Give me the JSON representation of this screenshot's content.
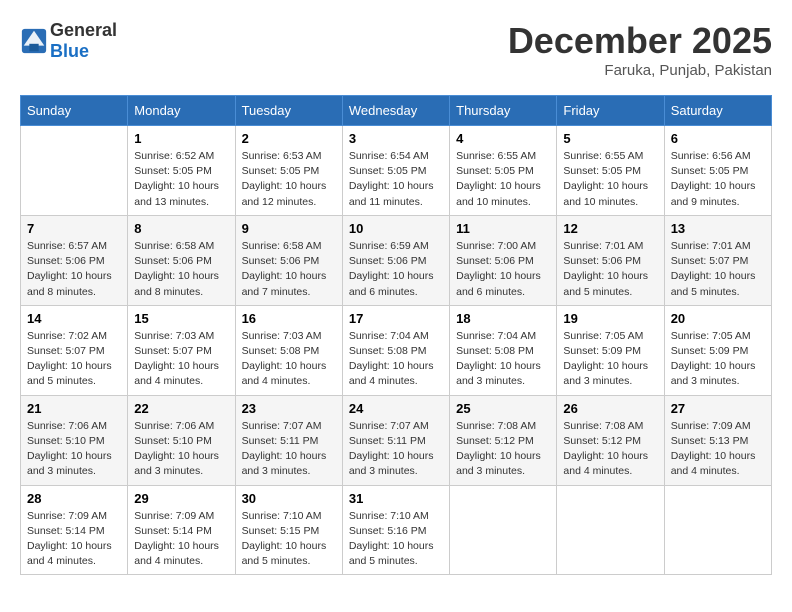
{
  "header": {
    "logo_general": "General",
    "logo_blue": "Blue",
    "month": "December 2025",
    "location": "Faruka, Punjab, Pakistan"
  },
  "days_of_week": [
    "Sunday",
    "Monday",
    "Tuesday",
    "Wednesday",
    "Thursday",
    "Friday",
    "Saturday"
  ],
  "weeks": [
    [
      {
        "day": "",
        "info": ""
      },
      {
        "day": "1",
        "info": "Sunrise: 6:52 AM\nSunset: 5:05 PM\nDaylight: 10 hours\nand 13 minutes."
      },
      {
        "day": "2",
        "info": "Sunrise: 6:53 AM\nSunset: 5:05 PM\nDaylight: 10 hours\nand 12 minutes."
      },
      {
        "day": "3",
        "info": "Sunrise: 6:54 AM\nSunset: 5:05 PM\nDaylight: 10 hours\nand 11 minutes."
      },
      {
        "day": "4",
        "info": "Sunrise: 6:55 AM\nSunset: 5:05 PM\nDaylight: 10 hours\nand 10 minutes."
      },
      {
        "day": "5",
        "info": "Sunrise: 6:55 AM\nSunset: 5:05 PM\nDaylight: 10 hours\nand 10 minutes."
      },
      {
        "day": "6",
        "info": "Sunrise: 6:56 AM\nSunset: 5:05 PM\nDaylight: 10 hours\nand 9 minutes."
      }
    ],
    [
      {
        "day": "7",
        "info": "Sunrise: 6:57 AM\nSunset: 5:06 PM\nDaylight: 10 hours\nand 8 minutes."
      },
      {
        "day": "8",
        "info": "Sunrise: 6:58 AM\nSunset: 5:06 PM\nDaylight: 10 hours\nand 8 minutes."
      },
      {
        "day": "9",
        "info": "Sunrise: 6:58 AM\nSunset: 5:06 PM\nDaylight: 10 hours\nand 7 minutes."
      },
      {
        "day": "10",
        "info": "Sunrise: 6:59 AM\nSunset: 5:06 PM\nDaylight: 10 hours\nand 6 minutes."
      },
      {
        "day": "11",
        "info": "Sunrise: 7:00 AM\nSunset: 5:06 PM\nDaylight: 10 hours\nand 6 minutes."
      },
      {
        "day": "12",
        "info": "Sunrise: 7:01 AM\nSunset: 5:06 PM\nDaylight: 10 hours\nand 5 minutes."
      },
      {
        "day": "13",
        "info": "Sunrise: 7:01 AM\nSunset: 5:07 PM\nDaylight: 10 hours\nand 5 minutes."
      }
    ],
    [
      {
        "day": "14",
        "info": "Sunrise: 7:02 AM\nSunset: 5:07 PM\nDaylight: 10 hours\nand 5 minutes."
      },
      {
        "day": "15",
        "info": "Sunrise: 7:03 AM\nSunset: 5:07 PM\nDaylight: 10 hours\nand 4 minutes."
      },
      {
        "day": "16",
        "info": "Sunrise: 7:03 AM\nSunset: 5:08 PM\nDaylight: 10 hours\nand 4 minutes."
      },
      {
        "day": "17",
        "info": "Sunrise: 7:04 AM\nSunset: 5:08 PM\nDaylight: 10 hours\nand 4 minutes."
      },
      {
        "day": "18",
        "info": "Sunrise: 7:04 AM\nSunset: 5:08 PM\nDaylight: 10 hours\nand 3 minutes."
      },
      {
        "day": "19",
        "info": "Sunrise: 7:05 AM\nSunset: 5:09 PM\nDaylight: 10 hours\nand 3 minutes."
      },
      {
        "day": "20",
        "info": "Sunrise: 7:05 AM\nSunset: 5:09 PM\nDaylight: 10 hours\nand 3 minutes."
      }
    ],
    [
      {
        "day": "21",
        "info": "Sunrise: 7:06 AM\nSunset: 5:10 PM\nDaylight: 10 hours\nand 3 minutes."
      },
      {
        "day": "22",
        "info": "Sunrise: 7:06 AM\nSunset: 5:10 PM\nDaylight: 10 hours\nand 3 minutes."
      },
      {
        "day": "23",
        "info": "Sunrise: 7:07 AM\nSunset: 5:11 PM\nDaylight: 10 hours\nand 3 minutes."
      },
      {
        "day": "24",
        "info": "Sunrise: 7:07 AM\nSunset: 5:11 PM\nDaylight: 10 hours\nand 3 minutes."
      },
      {
        "day": "25",
        "info": "Sunrise: 7:08 AM\nSunset: 5:12 PM\nDaylight: 10 hours\nand 3 minutes."
      },
      {
        "day": "26",
        "info": "Sunrise: 7:08 AM\nSunset: 5:12 PM\nDaylight: 10 hours\nand 4 minutes."
      },
      {
        "day": "27",
        "info": "Sunrise: 7:09 AM\nSunset: 5:13 PM\nDaylight: 10 hours\nand 4 minutes."
      }
    ],
    [
      {
        "day": "28",
        "info": "Sunrise: 7:09 AM\nSunset: 5:14 PM\nDaylight: 10 hours\nand 4 minutes."
      },
      {
        "day": "29",
        "info": "Sunrise: 7:09 AM\nSunset: 5:14 PM\nDaylight: 10 hours\nand 4 minutes."
      },
      {
        "day": "30",
        "info": "Sunrise: 7:10 AM\nSunset: 5:15 PM\nDaylight: 10 hours\nand 5 minutes."
      },
      {
        "day": "31",
        "info": "Sunrise: 7:10 AM\nSunset: 5:16 PM\nDaylight: 10 hours\nand 5 minutes."
      },
      {
        "day": "",
        "info": ""
      },
      {
        "day": "",
        "info": ""
      },
      {
        "day": "",
        "info": ""
      }
    ]
  ]
}
